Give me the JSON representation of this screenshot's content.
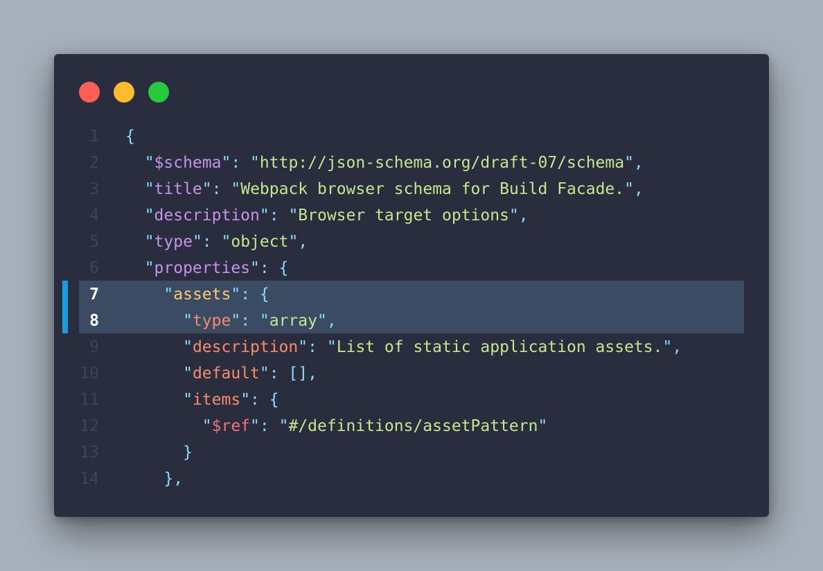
{
  "window": {
    "controls": [
      {
        "name": "close",
        "color": "#ff5f56"
      },
      {
        "name": "minimize",
        "color": "#ffbd2e"
      },
      {
        "name": "zoom",
        "color": "#27c93f"
      }
    ]
  },
  "colors": {
    "background": "#a7b1bc",
    "editor_bg": "#292d3e",
    "highlight_bg": "#3a4b63",
    "highlight_bar": "#1a9ee0",
    "line_number": "#3f4559",
    "punctuation": "#89ddff",
    "string": "#c3e88d",
    "key_level1": "#c792ea",
    "key_level2": "#ffcb6b",
    "key_level3": "#f78c6c",
    "key_level4": "#f07178"
  },
  "editor": {
    "highlighted_lines": [
      7,
      8
    ],
    "lines": [
      {
        "num": "1",
        "tokens": [
          {
            "t": "{",
            "c": "#89ddff"
          }
        ]
      },
      {
        "num": "2",
        "tokens": [
          {
            "t": "  \"",
            "c": "#89ddff"
          },
          {
            "t": "$schema",
            "c": "#c792ea"
          },
          {
            "t": "\"",
            "c": "#89ddff"
          },
          {
            "t": ": ",
            "c": "#89ddff"
          },
          {
            "t": "\"",
            "c": "#89ddff"
          },
          {
            "t": "http://json-schema.org/draft-07/schema",
            "c": "#c3e88d"
          },
          {
            "t": "\"",
            "c": "#89ddff"
          },
          {
            "t": ",",
            "c": "#89ddff"
          }
        ]
      },
      {
        "num": "3",
        "tokens": [
          {
            "t": "  \"",
            "c": "#89ddff"
          },
          {
            "t": "title",
            "c": "#c792ea"
          },
          {
            "t": "\"",
            "c": "#89ddff"
          },
          {
            "t": ": ",
            "c": "#89ddff"
          },
          {
            "t": "\"",
            "c": "#89ddff"
          },
          {
            "t": "Webpack browser schema for Build Facade.",
            "c": "#c3e88d"
          },
          {
            "t": "\"",
            "c": "#89ddff"
          },
          {
            "t": ",",
            "c": "#89ddff"
          }
        ]
      },
      {
        "num": "4",
        "tokens": [
          {
            "t": "  \"",
            "c": "#89ddff"
          },
          {
            "t": "description",
            "c": "#c792ea"
          },
          {
            "t": "\"",
            "c": "#89ddff"
          },
          {
            "t": ": ",
            "c": "#89ddff"
          },
          {
            "t": "\"",
            "c": "#89ddff"
          },
          {
            "t": "Browser target options",
            "c": "#c3e88d"
          },
          {
            "t": "\"",
            "c": "#89ddff"
          },
          {
            "t": ",",
            "c": "#89ddff"
          }
        ]
      },
      {
        "num": "5",
        "tokens": [
          {
            "t": "  \"",
            "c": "#89ddff"
          },
          {
            "t": "type",
            "c": "#c792ea"
          },
          {
            "t": "\"",
            "c": "#89ddff"
          },
          {
            "t": ": ",
            "c": "#89ddff"
          },
          {
            "t": "\"",
            "c": "#89ddff"
          },
          {
            "t": "object",
            "c": "#c3e88d"
          },
          {
            "t": "\"",
            "c": "#89ddff"
          },
          {
            "t": ",",
            "c": "#89ddff"
          }
        ]
      },
      {
        "num": "6",
        "tokens": [
          {
            "t": "  \"",
            "c": "#89ddff"
          },
          {
            "t": "properties",
            "c": "#c792ea"
          },
          {
            "t": "\"",
            "c": "#89ddff"
          },
          {
            "t": ": {",
            "c": "#89ddff"
          }
        ]
      },
      {
        "num": "7",
        "tokens": [
          {
            "t": "    \"",
            "c": "#89ddff"
          },
          {
            "t": "assets",
            "c": "#ffcb6b"
          },
          {
            "t": "\"",
            "c": "#89ddff"
          },
          {
            "t": ": {",
            "c": "#89ddff"
          }
        ]
      },
      {
        "num": "8",
        "tokens": [
          {
            "t": "      \"",
            "c": "#89ddff"
          },
          {
            "t": "type",
            "c": "#f78c6c"
          },
          {
            "t": "\"",
            "c": "#89ddff"
          },
          {
            "t": ": ",
            "c": "#89ddff"
          },
          {
            "t": "\"",
            "c": "#89ddff"
          },
          {
            "t": "array",
            "c": "#c3e88d"
          },
          {
            "t": "\"",
            "c": "#89ddff"
          },
          {
            "t": ",",
            "c": "#89ddff"
          }
        ]
      },
      {
        "num": "9",
        "tokens": [
          {
            "t": "      \"",
            "c": "#89ddff"
          },
          {
            "t": "description",
            "c": "#f78c6c"
          },
          {
            "t": "\"",
            "c": "#89ddff"
          },
          {
            "t": ": ",
            "c": "#89ddff"
          },
          {
            "t": "\"",
            "c": "#89ddff"
          },
          {
            "t": "List of static application assets.",
            "c": "#c3e88d"
          },
          {
            "t": "\"",
            "c": "#89ddff"
          },
          {
            "t": ",",
            "c": "#89ddff"
          }
        ]
      },
      {
        "num": "10",
        "tokens": [
          {
            "t": "      \"",
            "c": "#89ddff"
          },
          {
            "t": "default",
            "c": "#f78c6c"
          },
          {
            "t": "\"",
            "c": "#89ddff"
          },
          {
            "t": ": [],",
            "c": "#89ddff"
          }
        ]
      },
      {
        "num": "11",
        "tokens": [
          {
            "t": "      \"",
            "c": "#89ddff"
          },
          {
            "t": "items",
            "c": "#f78c6c"
          },
          {
            "t": "\"",
            "c": "#89ddff"
          },
          {
            "t": ": {",
            "c": "#89ddff"
          }
        ]
      },
      {
        "num": "12",
        "tokens": [
          {
            "t": "        \"",
            "c": "#89ddff"
          },
          {
            "t": "$ref",
            "c": "#f07178"
          },
          {
            "t": "\"",
            "c": "#89ddff"
          },
          {
            "t": ": ",
            "c": "#89ddff"
          },
          {
            "t": "\"",
            "c": "#89ddff"
          },
          {
            "t": "#/definitions/assetPattern",
            "c": "#c3e88d"
          },
          {
            "t": "\"",
            "c": "#89ddff"
          }
        ]
      },
      {
        "num": "13",
        "tokens": [
          {
            "t": "      }",
            "c": "#89ddff"
          }
        ]
      },
      {
        "num": "14",
        "tokens": [
          {
            "t": "    },",
            "c": "#89ddff"
          }
        ]
      }
    ]
  }
}
